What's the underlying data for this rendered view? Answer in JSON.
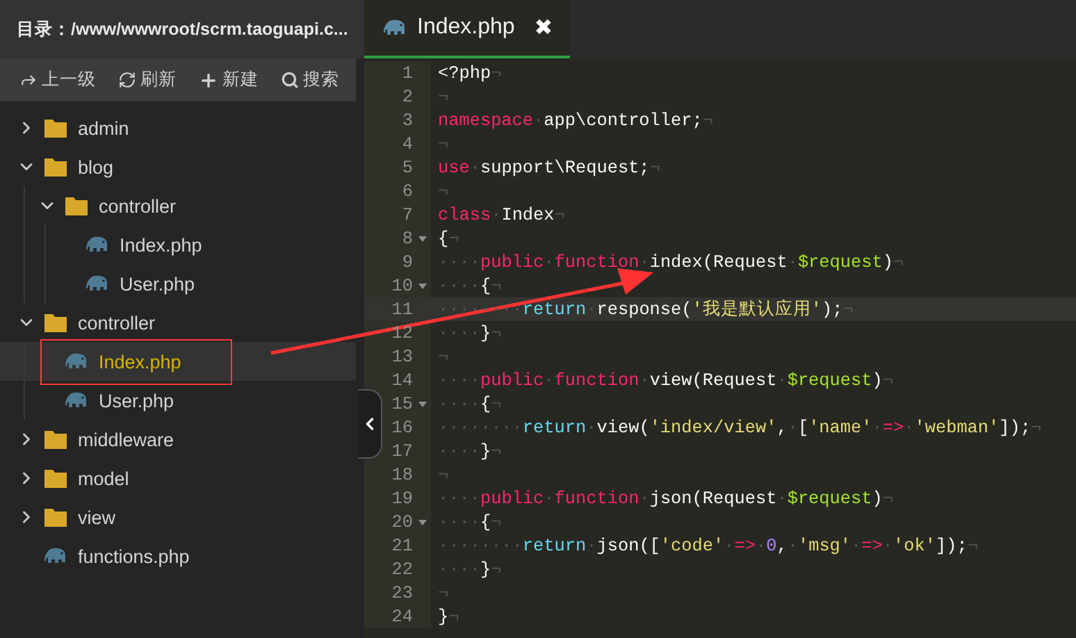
{
  "sidebar": {
    "title": "目录：/www/wwwroot/scrm.taoguapi.c...",
    "toolbar": [
      {
        "kind": "up",
        "label": "上一级"
      },
      {
        "kind": "refresh",
        "label": "刷新"
      },
      {
        "kind": "new",
        "label": "新建"
      },
      {
        "kind": "search",
        "label": "搜索"
      }
    ],
    "tree": [
      {
        "name": "admin",
        "kind": "folder",
        "expanded": false,
        "selected": false
      },
      {
        "name": "blog",
        "kind": "folder",
        "expanded": true,
        "selected": false,
        "children": [
          {
            "name": "controller",
            "kind": "folder",
            "expanded": true,
            "selected": false,
            "children": [
              {
                "name": "Index.php",
                "kind": "file",
                "selected": false
              },
              {
                "name": "User.php",
                "kind": "file",
                "selected": false
              }
            ]
          }
        ]
      },
      {
        "name": "controller",
        "kind": "folder",
        "expanded": true,
        "selected": false,
        "children": [
          {
            "name": "Index.php",
            "kind": "file",
            "selected": true
          },
          {
            "name": "User.php",
            "kind": "file",
            "selected": false
          }
        ]
      },
      {
        "name": "middleware",
        "kind": "folder",
        "expanded": false,
        "selected": false
      },
      {
        "name": "model",
        "kind": "folder",
        "expanded": false,
        "selected": false
      },
      {
        "name": "view",
        "kind": "folder",
        "expanded": false,
        "selected": false
      },
      {
        "name": "functions.php",
        "kind": "file",
        "selected": false
      }
    ]
  },
  "tabs": [
    {
      "label": "Index.php",
      "close": "✖",
      "selected": true
    }
  ],
  "editor": {
    "lines": [
      {
        "number": "1",
        "tokens": [
          {
            "kind": "plain",
            "text": "<?php"
          },
          {
            "kind": "ws",
            "text": "¬"
          }
        ]
      },
      {
        "number": "2",
        "tokens": [
          {
            "kind": "ws",
            "text": "¬"
          }
        ]
      },
      {
        "number": "3",
        "tokens": [
          {
            "kind": "keyword",
            "text": "namespace"
          },
          {
            "kind": "ws",
            "text": "·"
          },
          {
            "kind": "plain",
            "text": "app\\controller;"
          },
          {
            "kind": "ws",
            "text": "¬"
          }
        ]
      },
      {
        "number": "4",
        "tokens": [
          {
            "kind": "ws",
            "text": "¬"
          }
        ]
      },
      {
        "number": "5",
        "tokens": [
          {
            "kind": "keyword",
            "text": "use"
          },
          {
            "kind": "ws",
            "text": "·"
          },
          {
            "kind": "plain",
            "text": "support\\Request;"
          },
          {
            "kind": "ws",
            "text": "¬"
          }
        ]
      },
      {
        "number": "6",
        "tokens": [
          {
            "kind": "ws",
            "text": "¬"
          }
        ]
      },
      {
        "number": "7",
        "tokens": [
          {
            "kind": "keyword",
            "text": "class"
          },
          {
            "kind": "ws",
            "text": "·"
          },
          {
            "kind": "plain",
            "text": "Index"
          },
          {
            "kind": "ws",
            "text": "¬"
          }
        ]
      },
      {
        "number": "8",
        "foldable": true,
        "tokens": [
          {
            "kind": "plain",
            "text": "{"
          },
          {
            "kind": "ws",
            "text": "¬"
          }
        ]
      },
      {
        "number": "9",
        "tokens": [
          {
            "kind": "ws",
            "text": "····"
          },
          {
            "kind": "keyword",
            "text": "public"
          },
          {
            "kind": "ws",
            "text": "·"
          },
          {
            "kind": "keyword",
            "text": "function"
          },
          {
            "kind": "ws",
            "text": "·"
          },
          {
            "kind": "plain",
            "text": "index(Request"
          },
          {
            "kind": "ws",
            "text": "·"
          },
          {
            "kind": "variable",
            "text": "$request"
          },
          {
            "kind": "plain",
            "text": ")"
          },
          {
            "kind": "ws",
            "text": "¬"
          }
        ]
      },
      {
        "number": "10",
        "foldable": true,
        "tokens": [
          {
            "kind": "ws",
            "text": "····"
          },
          {
            "kind": "plain",
            "text": "{"
          },
          {
            "kind": "ws",
            "text": "¬"
          }
        ]
      },
      {
        "number": "11",
        "current": true,
        "tokens": [
          {
            "kind": "ws",
            "text": "········"
          },
          {
            "kind": "return",
            "text": "return"
          },
          {
            "kind": "ws",
            "text": "·"
          },
          {
            "kind": "plain",
            "text": "response("
          },
          {
            "kind": "string",
            "text": "'我是默认应用'"
          },
          {
            "kind": "plain",
            "text": ");"
          },
          {
            "kind": "ws",
            "text": "¬"
          }
        ]
      },
      {
        "number": "12",
        "tokens": [
          {
            "kind": "ws",
            "text": "····"
          },
          {
            "kind": "plain",
            "text": "}"
          },
          {
            "kind": "ws",
            "text": "¬"
          }
        ]
      },
      {
        "number": "13",
        "tokens": [
          {
            "kind": "ws",
            "text": "¬"
          }
        ]
      },
      {
        "number": "14",
        "tokens": [
          {
            "kind": "ws",
            "text": "····"
          },
          {
            "kind": "keyword",
            "text": "public"
          },
          {
            "kind": "ws",
            "text": "·"
          },
          {
            "kind": "keyword",
            "text": "function"
          },
          {
            "kind": "ws",
            "text": "·"
          },
          {
            "kind": "plain",
            "text": "view(Request"
          },
          {
            "kind": "ws",
            "text": "·"
          },
          {
            "kind": "variable",
            "text": "$request"
          },
          {
            "kind": "plain",
            "text": ")"
          },
          {
            "kind": "ws",
            "text": "¬"
          }
        ]
      },
      {
        "number": "15",
        "foldable": true,
        "tokens": [
          {
            "kind": "ws",
            "text": "····"
          },
          {
            "kind": "plain",
            "text": "{"
          },
          {
            "kind": "ws",
            "text": "¬"
          }
        ]
      },
      {
        "number": "16",
        "tokens": [
          {
            "kind": "ws",
            "text": "········"
          },
          {
            "kind": "return",
            "text": "return"
          },
          {
            "kind": "ws",
            "text": "·"
          },
          {
            "kind": "plain",
            "text": "view("
          },
          {
            "kind": "string",
            "text": "'index/view'"
          },
          {
            "kind": "plain",
            "text": ","
          },
          {
            "kind": "ws",
            "text": "·"
          },
          {
            "kind": "plain",
            "text": "["
          },
          {
            "kind": "string",
            "text": "'name'"
          },
          {
            "kind": "ws",
            "text": "·"
          },
          {
            "kind": "keyword",
            "text": "=>"
          },
          {
            "kind": "ws",
            "text": "·"
          },
          {
            "kind": "string",
            "text": "'webman'"
          },
          {
            "kind": "plain",
            "text": "]);"
          },
          {
            "kind": "ws",
            "text": "¬"
          }
        ]
      },
      {
        "number": "17",
        "tokens": [
          {
            "kind": "ws",
            "text": "····"
          },
          {
            "kind": "plain",
            "text": "}"
          },
          {
            "kind": "ws",
            "text": "¬"
          }
        ]
      },
      {
        "number": "18",
        "tokens": [
          {
            "kind": "ws",
            "text": "¬"
          }
        ]
      },
      {
        "number": "19",
        "tokens": [
          {
            "kind": "ws",
            "text": "····"
          },
          {
            "kind": "keyword",
            "text": "public"
          },
          {
            "kind": "ws",
            "text": "·"
          },
          {
            "kind": "keyword",
            "text": "function"
          },
          {
            "kind": "ws",
            "text": "·"
          },
          {
            "kind": "plain",
            "text": "json(Request"
          },
          {
            "kind": "ws",
            "text": "·"
          },
          {
            "kind": "variable",
            "text": "$request"
          },
          {
            "kind": "plain",
            "text": ")"
          },
          {
            "kind": "ws",
            "text": "¬"
          }
        ]
      },
      {
        "number": "20",
        "foldable": true,
        "tokens": [
          {
            "kind": "ws",
            "text": "····"
          },
          {
            "kind": "plain",
            "text": "{"
          },
          {
            "kind": "ws",
            "text": "¬"
          }
        ]
      },
      {
        "number": "21",
        "tokens": [
          {
            "kind": "ws",
            "text": "········"
          },
          {
            "kind": "return",
            "text": "return"
          },
          {
            "kind": "ws",
            "text": "·"
          },
          {
            "kind": "plain",
            "text": "json(["
          },
          {
            "kind": "string",
            "text": "'code'"
          },
          {
            "kind": "ws",
            "text": "·"
          },
          {
            "kind": "keyword",
            "text": "=>"
          },
          {
            "kind": "ws",
            "text": "·"
          },
          {
            "kind": "number",
            "text": "0"
          },
          {
            "kind": "plain",
            "text": ","
          },
          {
            "kind": "ws",
            "text": "·"
          },
          {
            "kind": "string",
            "text": "'msg'"
          },
          {
            "kind": "ws",
            "text": "·"
          },
          {
            "kind": "keyword",
            "text": "=>"
          },
          {
            "kind": "ws",
            "text": "·"
          },
          {
            "kind": "string",
            "text": "'ok'"
          },
          {
            "kind": "plain",
            "text": "]);"
          },
          {
            "kind": "ws",
            "text": "¬"
          }
        ]
      },
      {
        "number": "22",
        "tokens": [
          {
            "kind": "ws",
            "text": "····"
          },
          {
            "kind": "plain",
            "text": "}"
          },
          {
            "kind": "ws",
            "text": "¬"
          }
        ]
      },
      {
        "number": "23",
        "tokens": [
          {
            "kind": "ws",
            "text": "¬"
          }
        ]
      },
      {
        "number": "24",
        "tokens": [
          {
            "kind": "plain",
            "text": "}"
          },
          {
            "kind": "ws",
            "text": "¬"
          }
        ]
      }
    ]
  }
}
